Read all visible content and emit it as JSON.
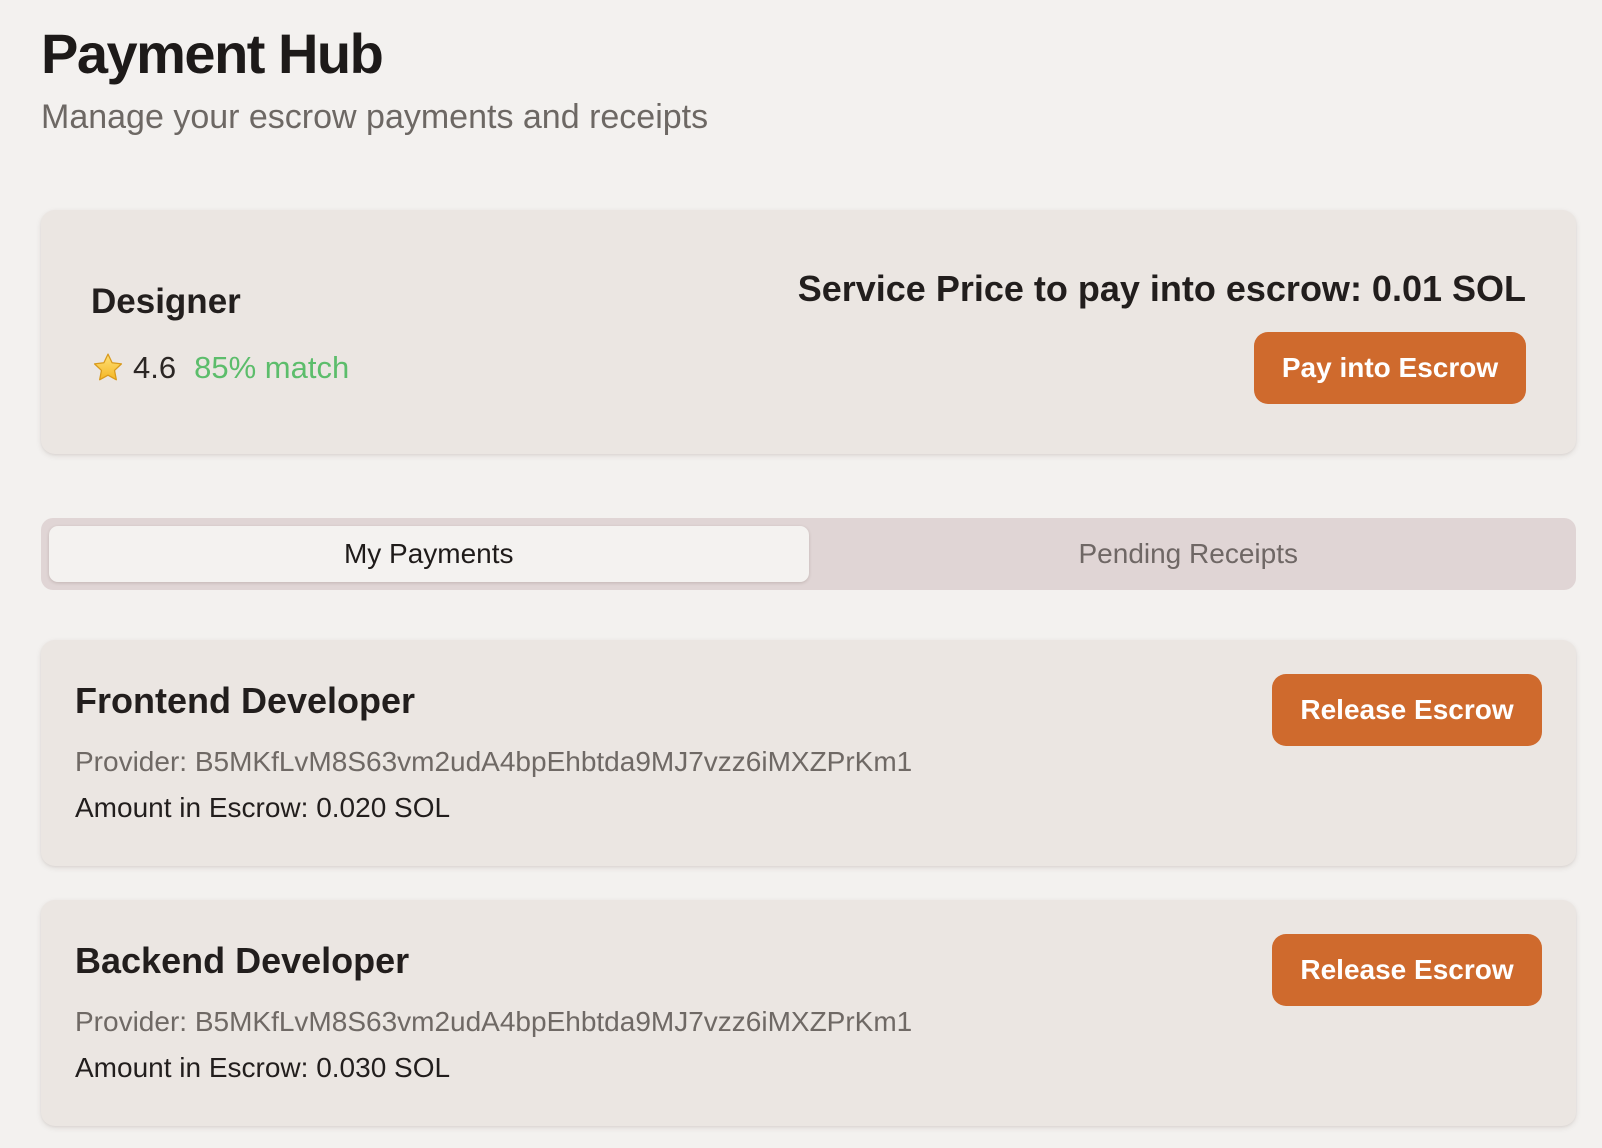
{
  "header": {
    "title": "Payment Hub",
    "subtitle": "Manage your escrow payments and receipts"
  },
  "service": {
    "name": "Designer",
    "rating_icon": "star-icon",
    "rating": "4.6",
    "match": "85% match",
    "price_text": "Service Price to pay into escrow: 0.01 SOL",
    "pay_button_label": "Pay into Escrow"
  },
  "tabs": [
    {
      "label": "My Payments",
      "active": true
    },
    {
      "label": "Pending Receipts",
      "active": false
    }
  ],
  "payments": [
    {
      "title": "Frontend Developer",
      "provider": "Provider: B5MKfLvM8S63vm2udA4bpEhbtda9MJ7vzz6iMXZPrKm1",
      "amount": "Amount in Escrow: 0.020 SOL",
      "button_label": "Release Escrow"
    },
    {
      "title": "Backend Developer",
      "provider": "Provider: B5MKfLvM8S63vm2udA4bpEhbtda9MJ7vzz6iMXZPrKm1",
      "amount": "Amount in Escrow: 0.030 SOL",
      "button_label": "Release Escrow"
    }
  ],
  "colors": {
    "background": "#f3f1ef",
    "card": "#ebe6e2",
    "accent": "#cf6a2d",
    "match_green": "#5cbd6b",
    "tab_track": "#e0d5d5"
  }
}
